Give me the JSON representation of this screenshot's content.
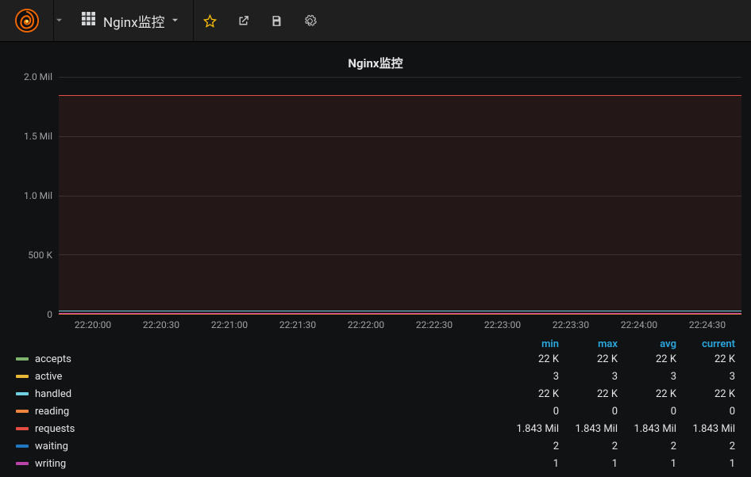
{
  "header": {
    "dashboard_name": "Nginx监控"
  },
  "panel": {
    "title": "Nginx监控"
  },
  "chart_data": {
    "type": "line",
    "title": "Nginx监控",
    "xlabel": "",
    "ylabel": "",
    "ylim": [
      0,
      2000000
    ],
    "y_ticks": [
      "0",
      "500 K",
      "1.0 Mil",
      "1.5 Mil",
      "2.0 Mil"
    ],
    "x_ticks": [
      "22:20:00",
      "22:20:30",
      "22:21:00",
      "22:21:30",
      "22:22:00",
      "22:22:30",
      "22:23:00",
      "22:23:30",
      "22:24:00",
      "22:24:30"
    ],
    "categories": [
      "22:20:00",
      "22:20:30",
      "22:21:00",
      "22:21:30",
      "22:22:00",
      "22:22:30",
      "22:23:00",
      "22:23:30",
      "22:24:00",
      "22:24:30"
    ],
    "series": [
      {
        "name": "accepts",
        "color": "#7eb26d",
        "values": [
          22000,
          22000,
          22000,
          22000,
          22000,
          22000,
          22000,
          22000,
          22000,
          22000
        ]
      },
      {
        "name": "active",
        "color": "#eab839",
        "values": [
          3,
          3,
          3,
          3,
          3,
          3,
          3,
          3,
          3,
          3
        ]
      },
      {
        "name": "handled",
        "color": "#6ed0e0",
        "values": [
          22000,
          22000,
          22000,
          22000,
          22000,
          22000,
          22000,
          22000,
          22000,
          22000
        ]
      },
      {
        "name": "reading",
        "color": "#ef843c",
        "values": [
          0,
          0,
          0,
          0,
          0,
          0,
          0,
          0,
          0,
          0
        ]
      },
      {
        "name": "requests",
        "color": "#e24d42",
        "values": [
          1843000,
          1843000,
          1843000,
          1843000,
          1843000,
          1843000,
          1843000,
          1843000,
          1843000,
          1843000
        ]
      },
      {
        "name": "waiting",
        "color": "#1f78c1",
        "values": [
          2,
          2,
          2,
          2,
          2,
          2,
          2,
          2,
          2,
          2
        ]
      },
      {
        "name": "writing",
        "color": "#ba43a9",
        "values": [
          1,
          1,
          1,
          1,
          1,
          1,
          1,
          1,
          1,
          1
        ]
      }
    ],
    "legend_cols": [
      "min",
      "max",
      "avg",
      "current"
    ],
    "legend": [
      {
        "name": "accepts",
        "color": "#7eb26d",
        "min": "22 K",
        "max": "22 K",
        "avg": "22 K",
        "current": "22 K"
      },
      {
        "name": "active",
        "color": "#eab839",
        "min": "3",
        "max": "3",
        "avg": "3",
        "current": "3"
      },
      {
        "name": "handled",
        "color": "#6ed0e0",
        "min": "22 K",
        "max": "22 K",
        "avg": "22 K",
        "current": "22 K"
      },
      {
        "name": "reading",
        "color": "#ef843c",
        "min": "0",
        "max": "0",
        "avg": "0",
        "current": "0"
      },
      {
        "name": "requests",
        "color": "#e24d42",
        "min": "1.843 Mil",
        "max": "1.843 Mil",
        "avg": "1.843 Mil",
        "current": "1.843 Mil"
      },
      {
        "name": "waiting",
        "color": "#1f78c1",
        "min": "2",
        "max": "2",
        "avg": "2",
        "current": "2"
      },
      {
        "name": "writing",
        "color": "#ba43a9",
        "min": "1",
        "max": "1",
        "avg": "1",
        "current": "1"
      }
    ]
  }
}
